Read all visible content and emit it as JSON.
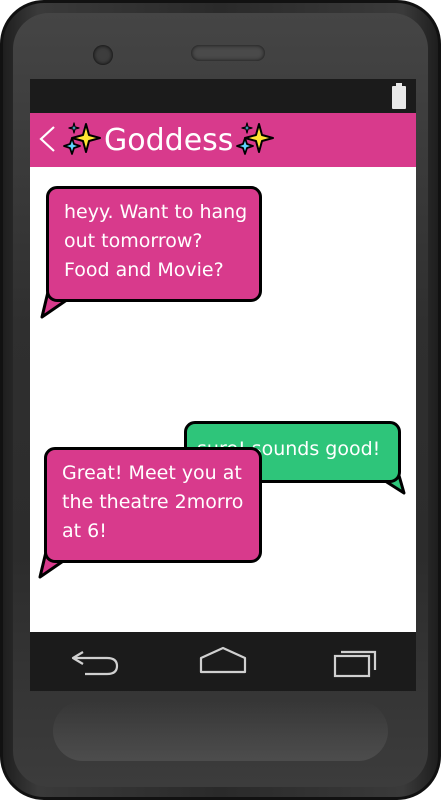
{
  "app_bar": {
    "contact_name": "Goddess",
    "background": "#d83a8c",
    "title_icons": [
      "sparkles-icon",
      "sparkles-icon"
    ]
  },
  "status_bar": {
    "icons": [
      "battery-icon"
    ]
  },
  "messages": [
    {
      "direction": "incoming",
      "lines": [
        "heyy. Want to hang",
        "out tomorrow?",
        "Food and Movie?"
      ],
      "color": "#d83a8c"
    },
    {
      "direction": "outgoing",
      "lines": [
        "sure! sounds good!"
      ],
      "color": "#2ec57a"
    },
    {
      "direction": "incoming",
      "lines": [
        "Great! Meet you at",
        "the theatre 2morro",
        "at 6!"
      ],
      "color": "#d83a8c"
    }
  ],
  "nav_bar": {
    "icons": [
      "back-icon",
      "home-icon",
      "recent-apps-icon"
    ]
  }
}
